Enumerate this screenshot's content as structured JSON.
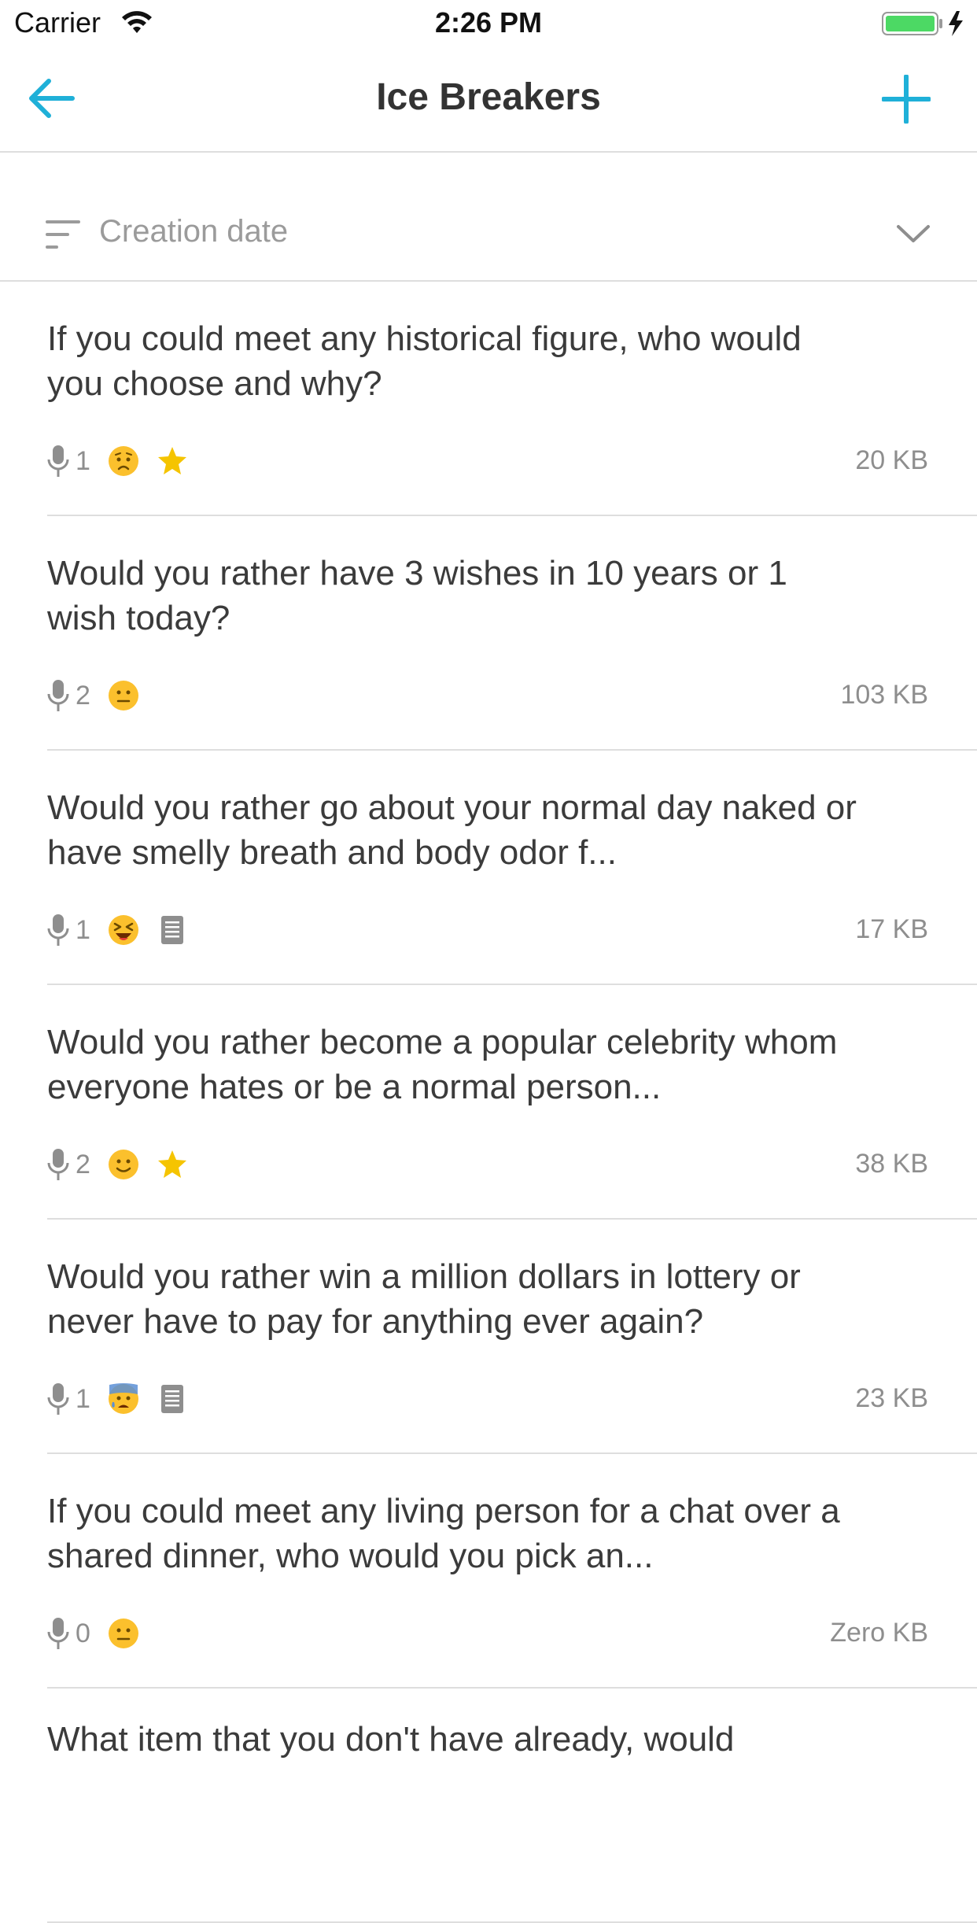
{
  "status_bar": {
    "carrier": "Carrier",
    "time": "2:26 PM"
  },
  "nav": {
    "title": "Ice Breakers",
    "back_icon": "arrow-left-icon",
    "add_icon": "plus-icon",
    "accent_color": "#1fb0d8"
  },
  "sort": {
    "label": "Creation date",
    "icon": "sort-lines-icon",
    "dropdown_icon": "chevron-down-icon"
  },
  "items": [
    {
      "title": "If you could meet any historical figure, who would you choose and why?",
      "recordings": "1",
      "mood": "sad-face",
      "starred": true,
      "has_note": false,
      "size": "20 KB"
    },
    {
      "title": "Would you rather have 3 wishes in 10 years or 1 wish today?",
      "recordings": "2",
      "mood": "neutral-face",
      "starred": false,
      "has_note": false,
      "size": "103 KB"
    },
    {
      "title": "Would you rather go about your normal day naked or have smelly breath and body odor f...",
      "recordings": "1",
      "mood": "laughing-face",
      "starred": false,
      "has_note": true,
      "size": "17 KB"
    },
    {
      "title": "Would you rather become a popular celebrity whom everyone hates or be a normal person...",
      "recordings": "2",
      "mood": "smiling-face",
      "starred": true,
      "has_note": false,
      "size": "38 KB"
    },
    {
      "title": "Would you rather win a million dollars in lottery or never have to pay for anything ever again?",
      "recordings": "1",
      "mood": "anxious-sweat-face",
      "starred": false,
      "has_note": true,
      "size": "23 KB"
    },
    {
      "title": "If you could meet any living person for a chat over a shared dinner, who would you pick an...",
      "recordings": "0",
      "mood": "neutral-face",
      "starred": false,
      "has_note": false,
      "size": "Zero KB"
    },
    {
      "title": "What item that you don't have already, would"
    }
  ],
  "colors": {
    "accent": "#1fb0d8",
    "star": "#f5c400",
    "emoji": "#fbc02d",
    "battery": "#4cd964",
    "muted_text": "#8e8e8e",
    "divider": "#dedede"
  }
}
